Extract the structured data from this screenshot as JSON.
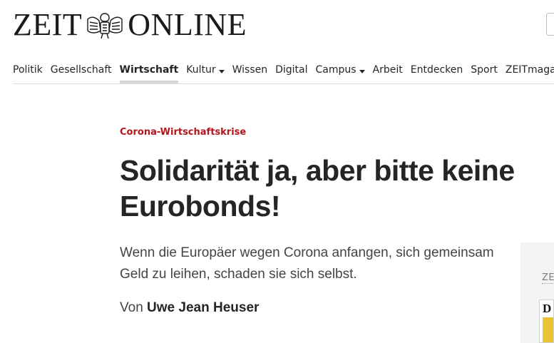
{
  "header": {
    "logo_left": "ZEIT",
    "logo_right": "ONLINE",
    "crest_icon": "eagle-crest-icon"
  },
  "nav": {
    "items": [
      {
        "label": "Politik",
        "active": false,
        "dropdown": false
      },
      {
        "label": "Gesellschaft",
        "active": false,
        "dropdown": false
      },
      {
        "label": "Wirtschaft",
        "active": true,
        "dropdown": false
      },
      {
        "label": "Kultur",
        "active": false,
        "dropdown": true
      },
      {
        "label": "Wissen",
        "active": false,
        "dropdown": false
      },
      {
        "label": "Digital",
        "active": false,
        "dropdown": false
      },
      {
        "label": "Campus",
        "active": false,
        "dropdown": true
      },
      {
        "label": "Arbeit",
        "active": false,
        "dropdown": false
      },
      {
        "label": "Entdecken",
        "active": false,
        "dropdown": false
      },
      {
        "label": "Sport",
        "active": false,
        "dropdown": false
      },
      {
        "label": "ZEITmagazin",
        "active": false,
        "dropdown": false
      }
    ]
  },
  "article": {
    "kicker": "Corona-Wirtschaftskrise",
    "headline": "Solidarität ja, aber bitte keine Eurobonds!",
    "summary": "Wenn die Europäer wegen Corona anfangen, sich gemeinsam Geld zu leihen, schaden sie sich selbst.",
    "byline_prefix": "Von",
    "author": "Uwe Jean Heuser"
  },
  "aside": {
    "label": "ZE",
    "thumb_letter": "D"
  },
  "colors": {
    "kicker": "#b4151c",
    "text": "#252525",
    "active_underline": "#d6d6d6"
  }
}
